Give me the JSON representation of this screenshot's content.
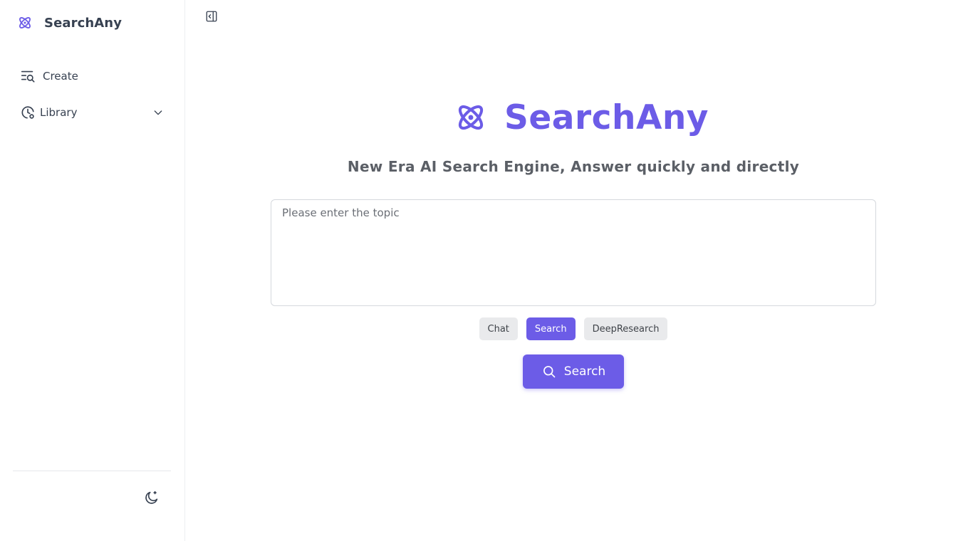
{
  "sidebar": {
    "brand_name": "SearchAny",
    "items": [
      {
        "label": "Create",
        "icon": "search-list-icon"
      },
      {
        "label": "Library",
        "icon": "clock-icon"
      }
    ],
    "theme_toggle_icon": "moon-icon"
  },
  "main": {
    "title": "SearchAny",
    "tagline": "New Era AI Search Engine, Answer quickly and directly",
    "input": {
      "placeholder": "Please enter the topic",
      "value": ""
    },
    "modes": [
      {
        "label": "Chat",
        "active": false
      },
      {
        "label": "Search",
        "active": true
      },
      {
        "label": "DeepResearch",
        "active": false
      }
    ],
    "search_button_label": "Search"
  },
  "colors": {
    "accent": "#6c5ce7",
    "text": "#374151",
    "muted": "#5b5f66",
    "chip_bg": "#e9eaec"
  }
}
